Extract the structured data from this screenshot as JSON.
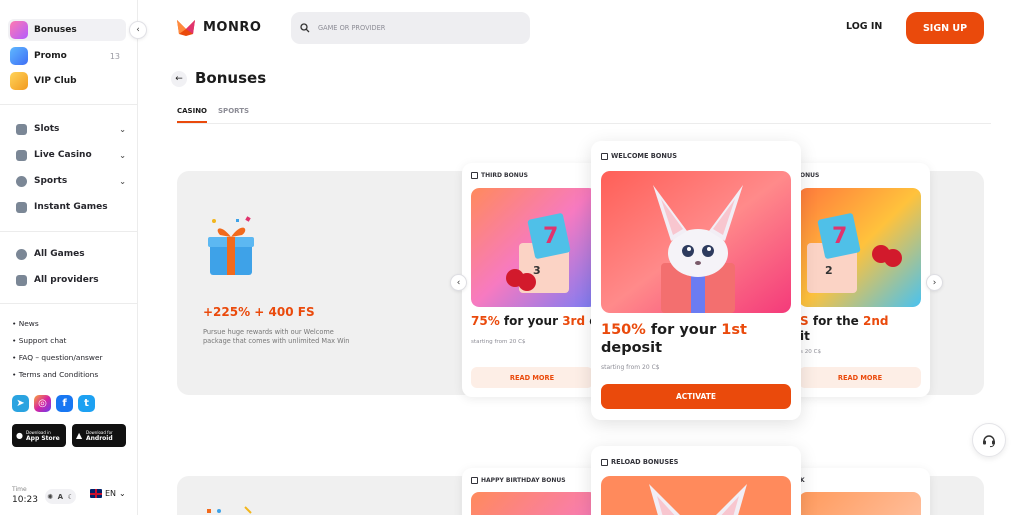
{
  "sidebar": {
    "top_items": [
      {
        "label": "Bonuses",
        "icon": "bonuses-icon"
      },
      {
        "label": "Promo",
        "icon": "promo-icon",
        "badge": "13"
      },
      {
        "label": "VIP Club",
        "icon": "vip-crown-icon"
      }
    ],
    "nav_items": [
      {
        "label": "Slots",
        "icon": "slots-icon"
      },
      {
        "label": "Live Casino",
        "icon": "live-casino-icon"
      },
      {
        "label": "Sports",
        "icon": "sports-ball-icon"
      },
      {
        "label": "Instant Games",
        "icon": "instant-games-icon"
      }
    ],
    "game_items": [
      {
        "label": "All Games",
        "icon": "all-games-icon"
      },
      {
        "label": "All providers",
        "icon": "providers-grid-icon"
      }
    ],
    "links": [
      "• News",
      "• Support chat",
      "• FAQ – question/answer",
      "• Terms and Conditions"
    ],
    "socials": [
      "telegram-icon",
      "instagram-icon",
      "facebook-icon",
      "twitter-icon"
    ],
    "stores": [
      {
        "small": "Download in",
        "big": "App Store"
      },
      {
        "small": "Download for",
        "big": "Android"
      }
    ],
    "time_label": "Time",
    "time_value": "10:23",
    "theme": "A",
    "language": "EN"
  },
  "header": {
    "brand": "MONRO",
    "search_placeholder": "GAME OR PROVIDER",
    "login": "LOG IN",
    "signup": "SIGN UP"
  },
  "page": {
    "title": "Bonuses",
    "tabs": [
      {
        "label": "CASINO",
        "active": true
      },
      {
        "label": "SPORTS",
        "active": false
      }
    ]
  },
  "banner": {
    "title": "+225% + 400 FS",
    "description": "Pursue huge rewards with our Welcome package that comes with unlimited Max Win"
  },
  "cards": {
    "left": {
      "tag": "THIRD BONUS",
      "pct": "75%",
      "mid": "for your",
      "ordinal": "3rd",
      "tail": "de",
      "sub": "starting from 20 C$",
      "button": "READ MORE"
    },
    "center": {
      "tag": "WELCOME BONUS",
      "pct": "150%",
      "mid": "for your",
      "ordinal": "1st",
      "tail": "deposit",
      "sub": "starting from 20 C$",
      "button": "ACTIVATE"
    },
    "right": {
      "tag": "ONUS",
      "head": "S",
      "mid": "for the",
      "ordinal": "2nd",
      "tail": "it",
      "sub": "s 20 C$",
      "button": "READ MORE"
    },
    "row2_left": {
      "tag": "HAPPY BIRTHDAY BONUS"
    },
    "row2_center": {
      "tag": "RELOAD BONUSES"
    },
    "row2_right": {
      "tag": "K"
    }
  },
  "colors": {
    "accent": "#ea4a0c",
    "sidebar_active": "#f1f1f4",
    "banner_bg": "#f0f0f0"
  }
}
